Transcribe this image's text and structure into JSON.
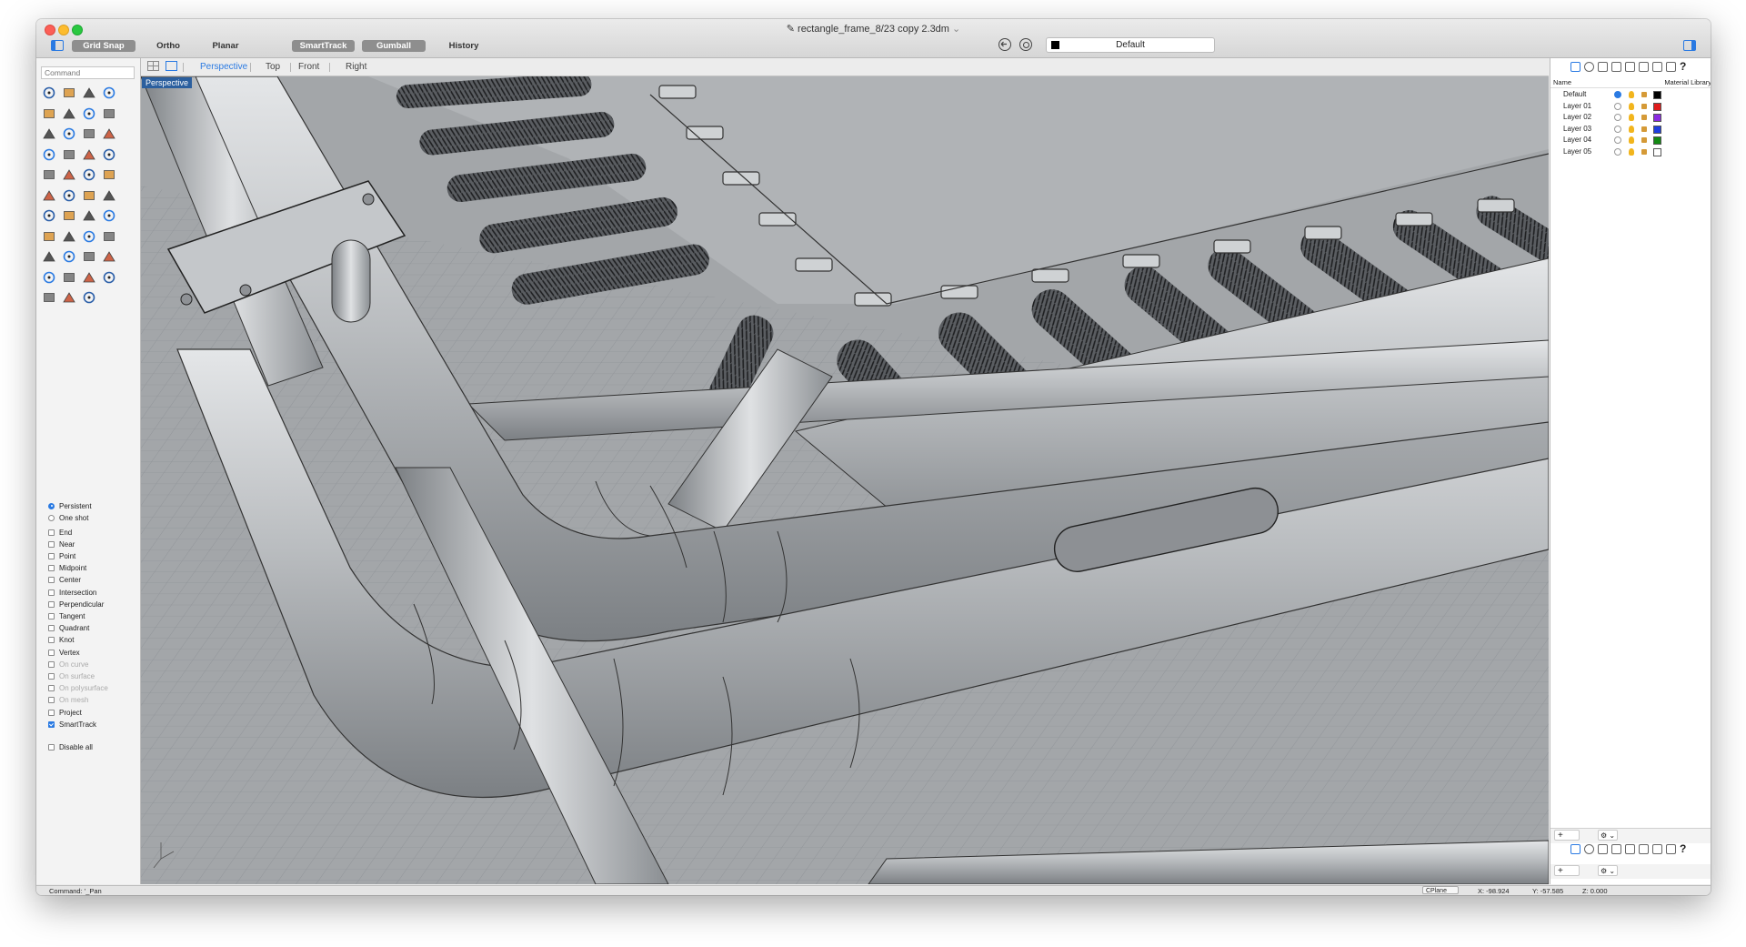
{
  "window": {
    "title": "rectangle_frame_8/23 copy 2.3dm",
    "title_chevron": "⌄"
  },
  "toolbar": {
    "grid_snap": "Grid Snap",
    "ortho": "Ortho",
    "planar": "Planar",
    "smarttrack": "SmartTrack",
    "gumball": "Gumball",
    "history": "History",
    "current_layer": "Default"
  },
  "command": {
    "placeholder": "Command",
    "status_prompt": "Command: '_Pan"
  },
  "viewport_tabs": [
    "Perspective",
    "Top",
    "Front",
    "Right"
  ],
  "viewport": {
    "label": "Perspective",
    "active_tab": "Perspective"
  },
  "osnap": {
    "persistent": "Persistent",
    "one_shot": "One shot",
    "items": [
      {
        "label": "End",
        "checked": false,
        "enabled": true
      },
      {
        "label": "Near",
        "checked": false,
        "enabled": true
      },
      {
        "label": "Point",
        "checked": false,
        "enabled": true
      },
      {
        "label": "Midpoint",
        "checked": false,
        "enabled": true
      },
      {
        "label": "Center",
        "checked": false,
        "enabled": true
      },
      {
        "label": "Intersection",
        "checked": false,
        "enabled": true
      },
      {
        "label": "Perpendicular",
        "checked": false,
        "enabled": true
      },
      {
        "label": "Tangent",
        "checked": false,
        "enabled": true
      },
      {
        "label": "Quadrant",
        "checked": false,
        "enabled": true
      },
      {
        "label": "Knot",
        "checked": false,
        "enabled": true
      },
      {
        "label": "Vertex",
        "checked": false,
        "enabled": true
      },
      {
        "label": "On curve",
        "checked": false,
        "enabled": false
      },
      {
        "label": "On surface",
        "checked": false,
        "enabled": false
      },
      {
        "label": "On polysurface",
        "checked": false,
        "enabled": false
      },
      {
        "label": "On mesh",
        "checked": false,
        "enabled": false
      },
      {
        "label": "Project",
        "checked": false,
        "enabled": true
      },
      {
        "label": "SmartTrack",
        "checked": true,
        "enabled": true
      }
    ],
    "disable_all": "Disable all"
  },
  "layers_panel": {
    "col_name": "Name",
    "col_material": "Material Library",
    "layers": [
      {
        "name": "Default",
        "current": true,
        "color": "#000000"
      },
      {
        "name": "Layer 01",
        "current": false,
        "color": "#e01b1b"
      },
      {
        "name": "Layer 02",
        "current": false,
        "color": "#8a2be2"
      },
      {
        "name": "Layer 03",
        "current": false,
        "color": "#1e3ee0"
      },
      {
        "name": "Layer 04",
        "current": false,
        "color": "#138a13"
      },
      {
        "name": "Layer 05",
        "current": false,
        "color": "#ffffff"
      }
    ],
    "add_button": "+",
    "options_button": "⚙ ⌄"
  },
  "status": {
    "cplane": "CPlane",
    "x": "X: -98.924",
    "y": "Y: -57.585",
    "z": "Z: 0.000"
  },
  "colors": {
    "accent": "#2a7ae2",
    "viewport_bg": "#9ea1a4",
    "viewport_label_bg": "#2b5f9e"
  }
}
